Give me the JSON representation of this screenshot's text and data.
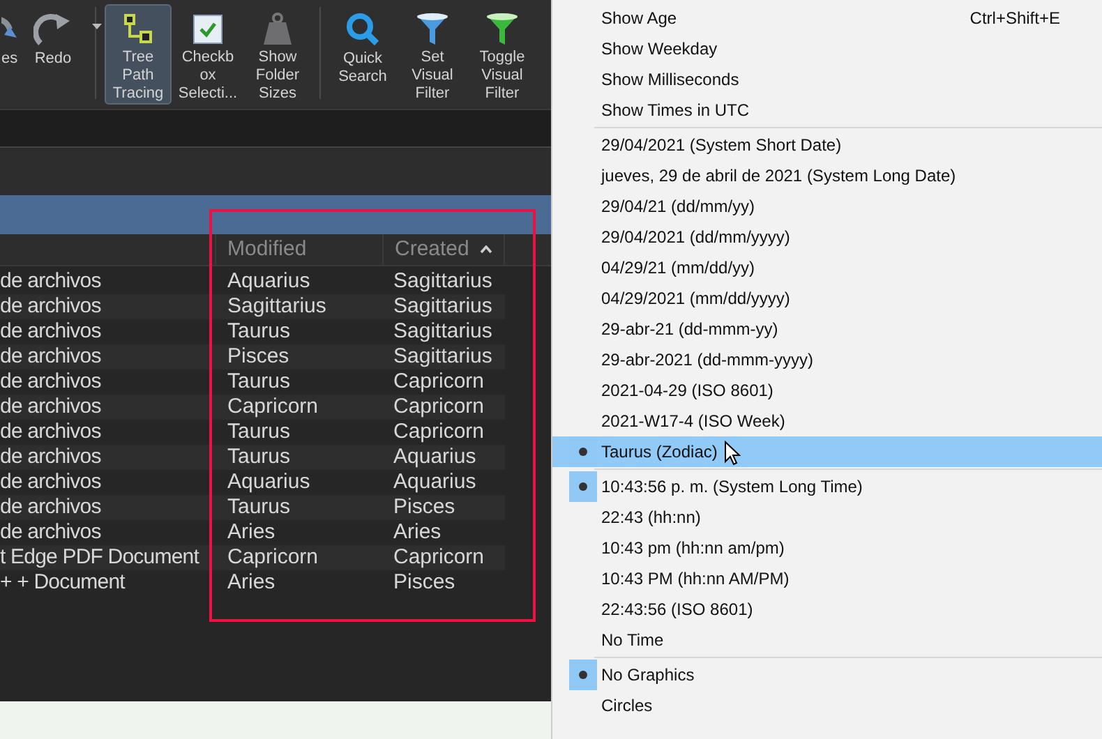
{
  "toolbar": {
    "buttons": [
      {
        "kind": "undo",
        "lines": [
          "es"
        ],
        "selected": false
      },
      {
        "kind": "redo",
        "lines": [
          "Redo"
        ],
        "selected": false,
        "dropdown": true
      },
      {
        "kind": "separator"
      },
      {
        "kind": "tree",
        "lines": [
          "Tree",
          "Path",
          "Tracing"
        ],
        "selected": true
      },
      {
        "kind": "checkbox",
        "lines": [
          "Checkb",
          "ox",
          "Selecti..."
        ],
        "selected": false
      },
      {
        "kind": "weight",
        "lines": [
          "Show",
          "Folder",
          "Sizes"
        ],
        "selected": false
      },
      {
        "kind": "separator"
      },
      {
        "kind": "search",
        "lines": [
          "Quick",
          "Search"
        ],
        "selected": false
      },
      {
        "kind": "filter",
        "lines": [
          "Set",
          "Visual",
          "Filter"
        ],
        "selected": false
      },
      {
        "kind": "filter-green",
        "lines": [
          "Toggle",
          "Visual",
          "Filter"
        ],
        "selected": false
      }
    ]
  },
  "table": {
    "columns": [
      {
        "sorted": false
      },
      {
        "label": "Modified",
        "sorted": false
      },
      {
        "label": "Created",
        "sorted": true
      }
    ],
    "rows": [
      [
        "de archivos",
        "Aquarius",
        "Sagittarius"
      ],
      [
        "de archivos",
        "Sagittarius",
        "Sagittarius"
      ],
      [
        "de archivos",
        "Taurus",
        "Sagittarius"
      ],
      [
        "de archivos",
        "Pisces",
        "Sagittarius"
      ],
      [
        "de archivos",
        "Taurus",
        "Capricorn"
      ],
      [
        "de archivos",
        "Capricorn",
        "Capricorn"
      ],
      [
        "de archivos",
        "Taurus",
        "Capricorn"
      ],
      [
        "de archivos",
        "Taurus",
        "Aquarius"
      ],
      [
        "de archivos",
        "Aquarius",
        "Aquarius"
      ],
      [
        "de archivos",
        "Taurus",
        "Pisces"
      ],
      [
        "de archivos",
        "Aries",
        "Aries"
      ],
      [
        "t Edge PDF Document",
        "Capricorn",
        "Capricorn"
      ],
      [
        "+ + Document",
        "Aries",
        "Pisces"
      ]
    ]
  },
  "menu": {
    "sections": [
      [
        {
          "label": "Show Age",
          "shortcut": "Ctrl+Shift+E",
          "checked": false,
          "highlighted": false
        },
        {
          "label": "Show Weekday",
          "checked": false,
          "highlighted": false
        },
        {
          "label": "Show Milliseconds",
          "checked": false,
          "highlighted": false
        },
        {
          "label": "Show Times in UTC",
          "checked": false,
          "highlighted": false
        }
      ],
      [
        {
          "label": "29/04/2021 (System Short Date)",
          "checked": false,
          "highlighted": false
        },
        {
          "label": "jueves, 29 de abril de 2021 (System Long Date)",
          "checked": false,
          "highlighted": false
        },
        {
          "label": "29/04/21 (dd/mm/yy)",
          "checked": false,
          "highlighted": false
        },
        {
          "label": "29/04/2021 (dd/mm/yyyy)",
          "checked": false,
          "highlighted": false
        },
        {
          "label": "04/29/21 (mm/dd/yy)",
          "checked": false,
          "highlighted": false
        },
        {
          "label": "04/29/2021 (mm/dd/yyyy)",
          "checked": false,
          "highlighted": false
        },
        {
          "label": "29-abr-21 (dd-mmm-yy)",
          "checked": false,
          "highlighted": false
        },
        {
          "label": "29-abr-2021 (dd-mmm-yyyy)",
          "checked": false,
          "highlighted": false
        },
        {
          "label": "2021-04-29 (ISO 8601)",
          "checked": false,
          "highlighted": false
        },
        {
          "label": "2021-W17-4 (ISO Week)",
          "checked": false,
          "highlighted": false
        },
        {
          "label": "Taurus (Zodiac)",
          "checked": true,
          "highlighted": true
        }
      ],
      [
        {
          "label": "10:43:56 p. m. (System Long Time)",
          "checked": true,
          "highlighted": false
        },
        {
          "label": "22:43 (hh:nn)",
          "checked": false,
          "highlighted": false
        },
        {
          "label": "10:43 pm (hh:nn am/pm)",
          "checked": false,
          "highlighted": false
        },
        {
          "label": "10:43 PM (hh:nn AM/PM)",
          "checked": false,
          "highlighted": false
        },
        {
          "label": "22:43:56 (ISO 8601)",
          "checked": false,
          "highlighted": false
        },
        {
          "label": "No Time",
          "checked": false,
          "highlighted": false
        }
      ],
      [
        {
          "label": "No Graphics",
          "checked": true,
          "highlighted": false
        },
        {
          "label": "Circles",
          "checked": false,
          "highlighted": false
        }
      ]
    ]
  }
}
